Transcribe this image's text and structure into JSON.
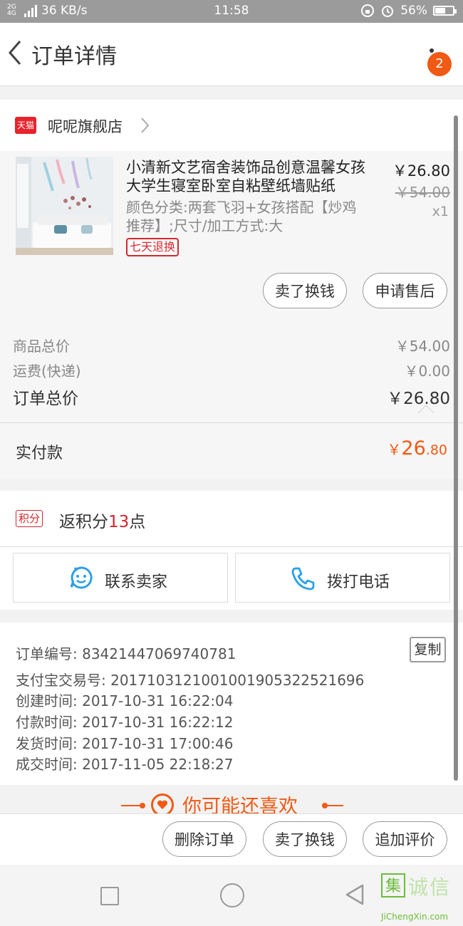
{
  "status_bar": {
    "net_labels": "2G 4G",
    "speed": "36 KB/s",
    "time": "11:58",
    "battery": "56%"
  },
  "header": {
    "title": "订单详情",
    "badge_count": "2"
  },
  "shop": {
    "badge": "天猫",
    "name": "呢呢旗舰店"
  },
  "product": {
    "title": "小清新文艺宿舍装饰品创意温馨女孩大学生寝室卧室自粘壁纸墙贴纸",
    "spec": "颜色分类:两套飞羽+女孩搭配【炒鸡推荐】;尺寸/加工方式:大",
    "tag": "七天退换",
    "price": "￥26.80",
    "original_price": "￥54.00",
    "quantity": "x1",
    "actions": [
      "卖了换钱",
      "申请售后"
    ]
  },
  "price_summary": {
    "goods_total_label": "商品总价",
    "goods_total_value": "￥54.00",
    "shipping_label": "运费(快递)",
    "shipping_value": "￥0.00",
    "order_total_label": "订单总价",
    "order_total_value": "￥26.80"
  },
  "payment": {
    "label": "实付款",
    "currency": "￥",
    "amount_int": "26",
    "amount_dec": ".80"
  },
  "points": {
    "badge": "积分",
    "prefix": "返积分",
    "value": "13",
    "suffix": "点"
  },
  "contact": {
    "seller_label": "联系卖家",
    "phone_label": "拨打电话"
  },
  "order_info": {
    "order_no": "订单编号: 83421447069740781",
    "copy_label": "复制",
    "alipay_no": "支付宝交易号: 2017103121001001905322521696",
    "created": "创建时间: 2017-10-31 16:22:04",
    "paid": "付款时间: 2017-10-31 16:22:12",
    "shipped": "发货时间: 2017-10-31 17:00:46",
    "completed": "成交时间: 2017-11-05 22:18:27"
  },
  "recommend": {
    "title": "你可能还喜欢"
  },
  "bottom_actions": [
    "删除订单",
    "卖了换钱",
    "追加评价"
  ],
  "watermark": {
    "logo": "集",
    "text": "诚信",
    "url": "JiChengXin.com"
  }
}
